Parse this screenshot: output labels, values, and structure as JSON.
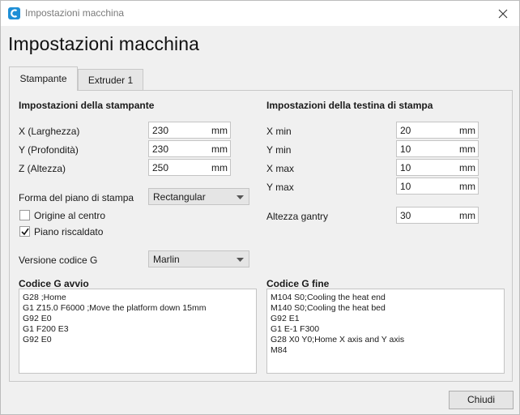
{
  "window": {
    "title": "Impostazioni macchina",
    "close_icon": "close-icon",
    "app_icon": "cura-logo-icon",
    "accent": "#1f8fd6"
  },
  "heading": "Impostazioni macchina",
  "tabs": [
    {
      "label": "Stampante",
      "active": true
    },
    {
      "label": "Extruder 1",
      "active": false
    }
  ],
  "printer": {
    "title": "Impostazioni della stampante",
    "x_label": "X (Larghezza)",
    "x_value": "230",
    "x_unit": "mm",
    "y_label": "Y (Profondità)",
    "y_value": "230",
    "y_unit": "mm",
    "z_label": "Z (Altezza)",
    "z_value": "250",
    "z_unit": "mm",
    "bed_shape_label": "Forma del piano di stampa",
    "bed_shape_value": "Rectangular",
    "origin_center_label": "Origine al centro",
    "origin_center_checked": false,
    "heated_bed_label": "Piano riscaldato",
    "heated_bed_checked": true,
    "gcode_flavor_label": "Versione codice G",
    "gcode_flavor_value": "Marlin"
  },
  "printhead": {
    "title": "Impostazioni della testina di stampa",
    "xmin_label": "X min",
    "xmin_value": "20",
    "xmin_unit": "mm",
    "ymin_label": "Y min",
    "ymin_value": "10",
    "ymin_unit": "mm",
    "xmax_label": "X max",
    "xmax_value": "10",
    "xmax_unit": "mm",
    "ymax_label": "Y max",
    "ymax_value": "10",
    "ymax_unit": "mm",
    "gantry_label": "Altezza gantry",
    "gantry_value": "30",
    "gantry_unit": "mm"
  },
  "start_gcode": {
    "title": "Codice G avvio",
    "text": "G28 ;Home\nG1 Z15.0 F6000 ;Move the platform down 15mm\nG92 E0\nG1 F200 E3\nG92 E0"
  },
  "end_gcode": {
    "title": "Codice G fine",
    "text": "M104 S0;Cooling the heat end\nM140 S0;Cooling the heat bed\nG92 E1\nG1 E-1 F300\nG28 X0 Y0;Home X axis and Y axis\nM84"
  },
  "footer": {
    "close_label": "Chiudi"
  }
}
